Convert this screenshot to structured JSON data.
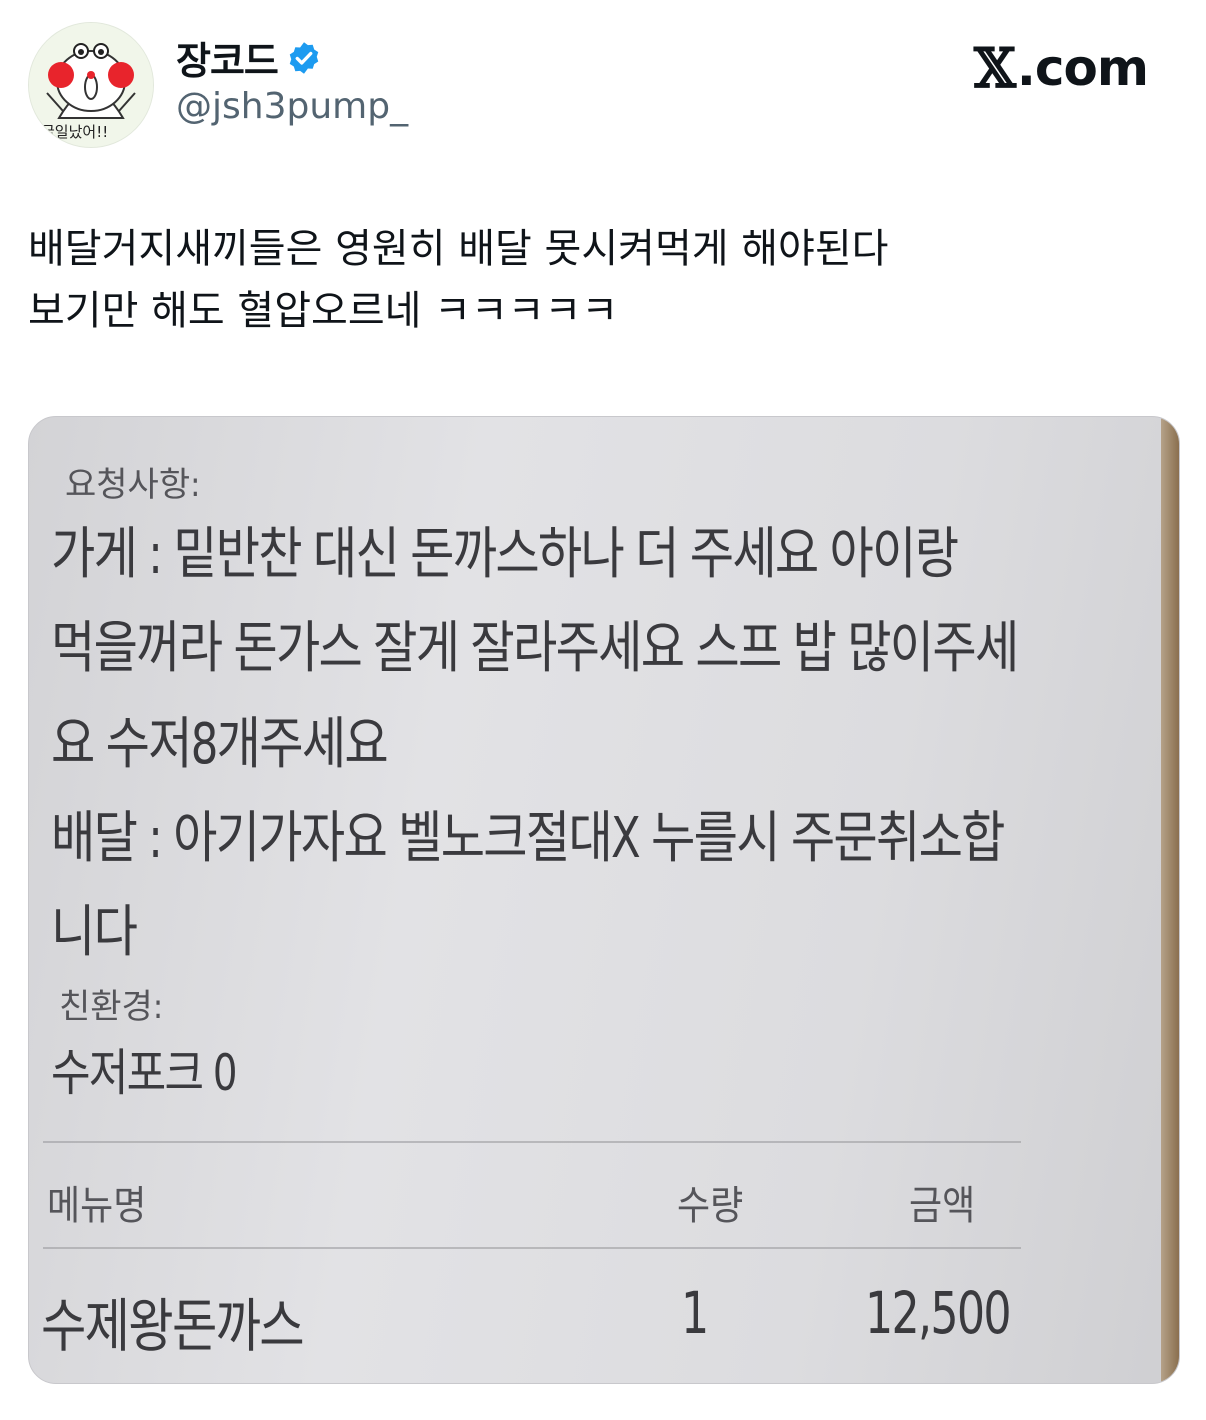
{
  "author": {
    "display_name": "장코드",
    "handle": "@jsh3pump_",
    "avatar_caption": "굴일났어!!",
    "verified_color": "#1d9bf0"
  },
  "brand": {
    "x": "𝕏",
    "domain": ".com"
  },
  "tweet": {
    "lines": [
      "배달거지새끼들은 영원히 배달 못시켜먹게 해야된다",
      "보기만 해도 혈압오르네 ㅋㅋㅋㅋㅋ"
    ]
  },
  "receipt": {
    "request_label": "요청사항:",
    "store_lines": [
      "가게 : 밑반찬 대신 돈까스하나 더 주세요 아이랑",
      "먹을꺼라 돈가스 잘게 잘라주세요 스프 밥 많이주세",
      "요 수저8개주세요"
    ],
    "delivery_lines": [
      "배달 : 아기가자요 벨노크절대X 누를시 주문취소합",
      "니다"
    ],
    "eco_label": "친환경:",
    "eco_value": "수저포크 0",
    "columns": {
      "menu": "메뉴명",
      "qty": "수량",
      "amount": "금액"
    },
    "items": [
      {
        "name": "수제왕돈까스",
        "qty": "1",
        "amount": "12,500"
      }
    ]
  }
}
